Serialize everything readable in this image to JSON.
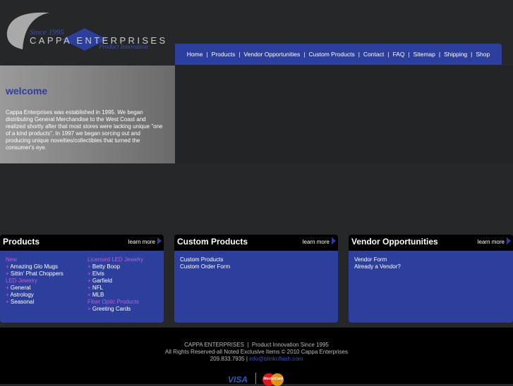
{
  "logo": {
    "since": "Since 1995",
    "name": "CAPPA ENTERPRISES",
    "tagline": "Product Innovation"
  },
  "nav": [
    "Home",
    "Products",
    "Vendor Opportunities",
    "Custom Products",
    "Contact",
    "FAQ",
    "Sitemap",
    "Shipping",
    "Shop"
  ],
  "welcome": {
    "title": "welcome",
    "body": "Cappa Enterprises was established in 1995. We began distributing General Merchandise to the West Coast and realized shortly after that most stores were lacking unique \"one of a kind products\". In 1997 we began sorcing out and producing unique novelties/collectibles that turned the consumer's eye."
  },
  "learn_more": "learn more",
  "products": {
    "title": "Products",
    "col1": [
      {
        "t": "cat",
        "v": "New"
      },
      {
        "t": "item",
        "v": "Amazing Glo Mugs"
      },
      {
        "t": "item",
        "v": "Sittin' Phat Choppers"
      },
      {
        "t": "cat",
        "v": "LED Jewelry"
      },
      {
        "t": "item",
        "v": "General"
      },
      {
        "t": "item",
        "v": "Astrology"
      },
      {
        "t": "item",
        "v": "Seasonal"
      }
    ],
    "col2": [
      {
        "t": "cat",
        "v": "Licensed LED Jewelry"
      },
      {
        "t": "item",
        "v": "Betty Boop"
      },
      {
        "t": "item",
        "v": "Elvis"
      },
      {
        "t": "item",
        "v": "Garfield"
      },
      {
        "t": "item",
        "v": "NFL"
      },
      {
        "t": "item",
        "v": "MLB"
      },
      {
        "t": "cat",
        "v": "Fiber Optic Products"
      },
      {
        "t": "item",
        "v": "Greeting Cards"
      }
    ]
  },
  "custom": {
    "title": "Custom Products",
    "links": [
      "Custom Products",
      "Custom Order Form"
    ]
  },
  "vendor": {
    "title": "Vendor Opportunities",
    "links": [
      "Vendor Form",
      "Already a Vendor?"
    ]
  },
  "footer": {
    "line1": "CAPPA ENTERPRISES  |  Product Innovation Since 1995",
    "line2": "All Rights Reserved-all Noted Exclusive Items © 2010 Cappa Enterprises",
    "phone": "209.833.7935",
    "email": "info@blinknflash.com",
    "visa": "VISA",
    "mc": "MasterCard"
  }
}
